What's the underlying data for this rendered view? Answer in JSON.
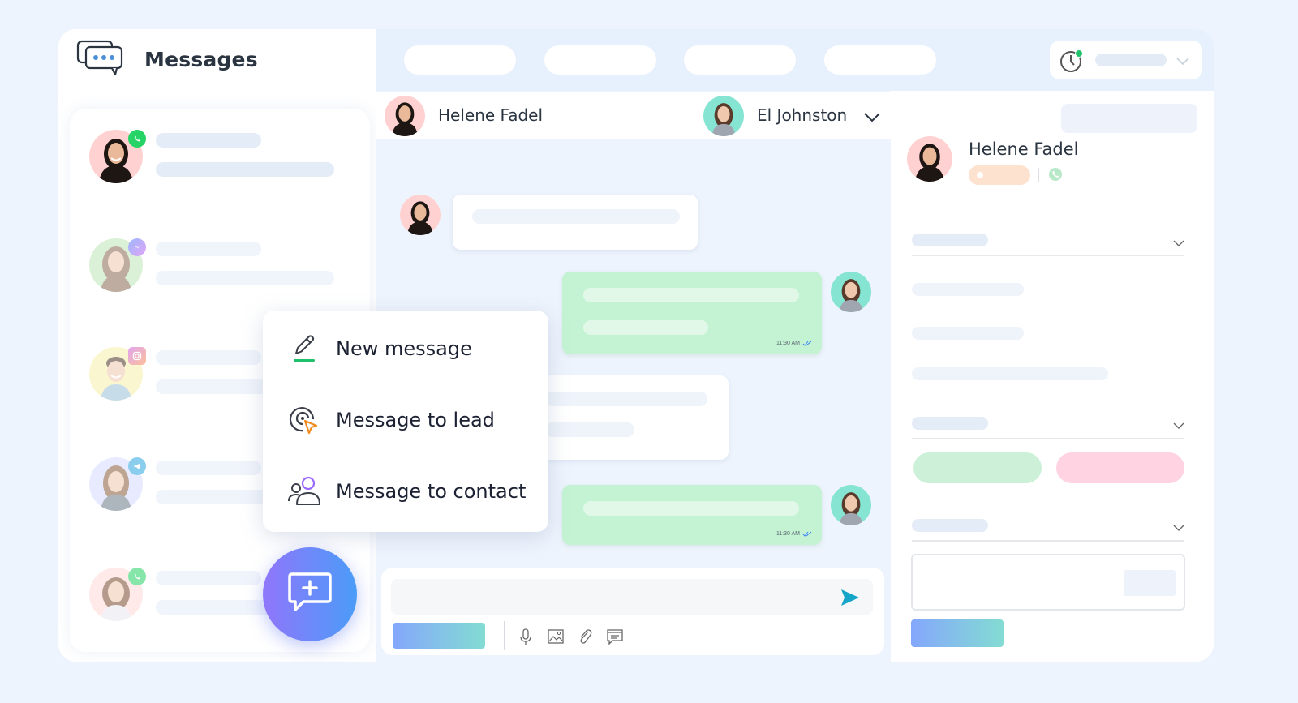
{
  "app": {
    "title": "Messages",
    "icon": "chat-bubbles-icon"
  },
  "topbar": {
    "nav_pills": [
      "",
      "",
      "",
      ""
    ],
    "status": {
      "icon": "clock-icon",
      "online_indicator_color": "#1fc16b"
    }
  },
  "conversations": [
    {
      "channel": "whatsapp",
      "channel_icon": "whatsapp-icon",
      "avatar_bg": "#ffd1d1",
      "active": true
    },
    {
      "channel": "messenger",
      "channel_icon": "messenger-icon",
      "avatar_bg": "#bfe6b7",
      "active": false
    },
    {
      "channel": "instagram",
      "channel_icon": "instagram-icon",
      "avatar_bg": "#f6f0a8",
      "active": false
    },
    {
      "channel": "telegram",
      "channel_icon": "telegram-icon",
      "avatar_bg": "#d6dcff",
      "active": false
    },
    {
      "channel": "whatsapp",
      "channel_icon": "whatsapp-icon",
      "avatar_bg": "#ffd8d8",
      "active": false
    }
  ],
  "chat": {
    "contact_name": "Helene Fadel",
    "agent_name": "El Johnston",
    "messages": [
      {
        "direction": "incoming",
        "sender": "Helene Fadel"
      },
      {
        "direction": "outgoing",
        "sender": "El Johnston",
        "time": "11:30 AM",
        "status": "read"
      },
      {
        "direction": "incoming",
        "sender": "Helene Fadel"
      },
      {
        "direction": "outgoing",
        "sender": "El Johnston",
        "time": "11:30 AM",
        "status": "read"
      }
    ],
    "composer": {
      "placeholder": "",
      "tools": [
        "microphone-icon",
        "image-icon",
        "paperclip-icon",
        "template-icon"
      ],
      "send_icon": "send-icon"
    }
  },
  "contact_panel": {
    "name": "Helene Fadel",
    "channel_icon": "whatsapp-icon",
    "tag_color": "#fde2cf",
    "sections": [
      "",
      "",
      ""
    ],
    "chip_colors": [
      "#ccf1d8",
      "#ffd3e2"
    ]
  },
  "new_message_menu": {
    "items": [
      {
        "label": "New message",
        "icon": "pencil-icon"
      },
      {
        "label": "Message to lead",
        "icon": "target-cursor-icon"
      },
      {
        "label": "Message to contact",
        "icon": "contacts-icon"
      }
    ]
  },
  "fab": {
    "icon": "chat-plus-icon"
  },
  "colors": {
    "accent_green": "#1fc16b",
    "outgoing_bubble": "#c3f3d3",
    "send": "#15a5c8",
    "fab_start": "#9076fa",
    "fab_end": "#4b9cf8"
  }
}
